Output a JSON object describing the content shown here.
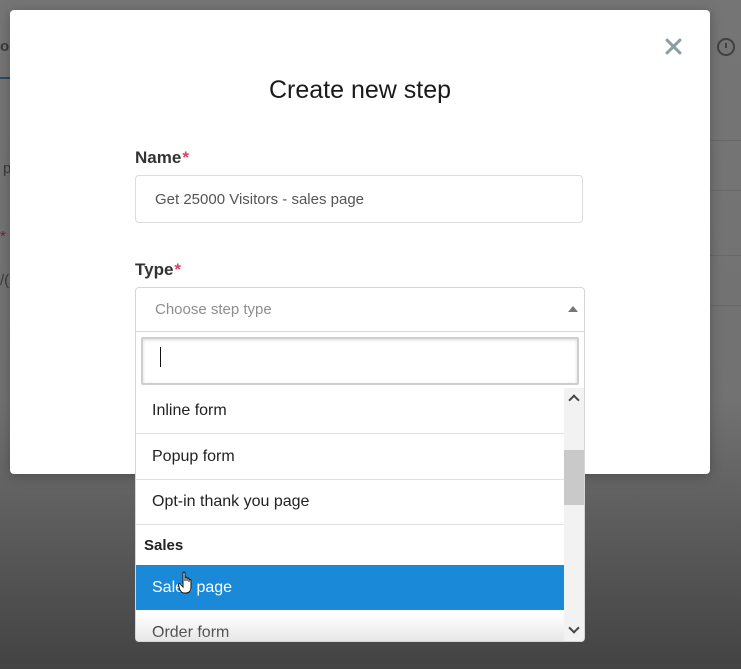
{
  "background": {
    "fragments": [
      "o",
      "p",
      "*",
      "/("
    ]
  },
  "modal": {
    "title": "Create new step",
    "close_icon": "close-icon",
    "name_label": "Name",
    "name_required_mark": "*",
    "name_value": "Get 25000 Visitors - sales page",
    "type_label": "Type",
    "type_required_mark": "*"
  },
  "type_select": {
    "placeholder": "Choose step type",
    "search_value": "",
    "options": [
      {
        "label": "Inline form",
        "group": false,
        "selected": false
      },
      {
        "label": "Popup form",
        "group": false,
        "selected": false
      },
      {
        "label": "Opt-in thank you page",
        "group": false,
        "selected": false
      },
      {
        "label": "Sales",
        "group": true,
        "selected": false
      },
      {
        "label": "Sales page",
        "group": false,
        "selected": true
      },
      {
        "label": "Order form",
        "group": false,
        "selected": false
      }
    ],
    "selected_option": "Sales page"
  },
  "colors": {
    "accent": "#1a8ad8",
    "required": "#e0405c",
    "close_icon": "#8aa0a0"
  },
  "cursor_icon": "hand-pointer-icon"
}
